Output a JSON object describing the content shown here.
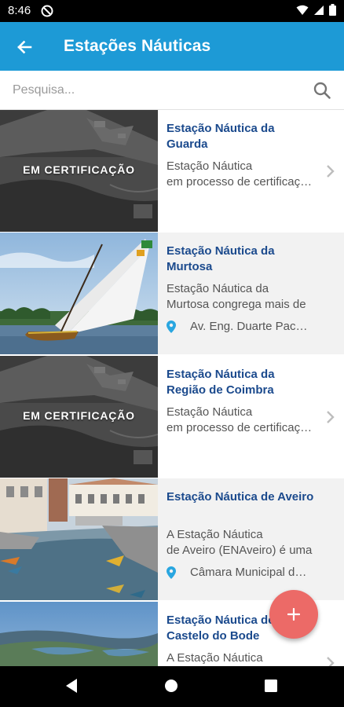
{
  "status_bar": {
    "time": "8:46"
  },
  "app_bar": {
    "title": "Estações Náuticas",
    "color": "#1d9ad6"
  },
  "search": {
    "placeholder": "Pesquisa..."
  },
  "items": [
    {
      "title": "Estação Náutica da Guarda",
      "description_lines": [
        "Estação Náutica",
        "em processo de certificação"
      ],
      "image_label": "EM CERTIFICAÇÃO",
      "location": ""
    },
    {
      "title": "Estação Náutica da Murtosa",
      "description_lines": [
        "Estação Náutica da",
        "Murtosa congrega mais de"
      ],
      "image_label": "",
      "location": "Av. Eng. Duarte Pacheco"
    },
    {
      "title": "Estação Náutica da Região de Coimbra",
      "description_lines": [
        "Estação Náutica",
        "em processo de certificação"
      ],
      "image_label": "EM CERTIFICAÇÃO",
      "location": ""
    },
    {
      "title": "Estação Náutica de Aveiro",
      "description_lines": [
        "A Estação Náutica",
        "de Aveiro (ENAveiro) é uma"
      ],
      "image_label": "",
      "location": "Câmara Municipal de Aveiro"
    },
    {
      "title": "Estação Náutica de Castelo do Bode",
      "description_lines": [
        "A Estação Náutica",
        ""
      ],
      "image_label": "",
      "location": ""
    }
  ],
  "colors": {
    "title_text": "#1b4a8d",
    "fab": "#ec6a67",
    "alt_row": "#f2f2f2"
  },
  "icons": {
    "back": "arrow-left-icon",
    "search": "search-icon",
    "location": "map-pin-icon",
    "chevron": "chevron-right-icon",
    "fab": "plus-icon"
  }
}
